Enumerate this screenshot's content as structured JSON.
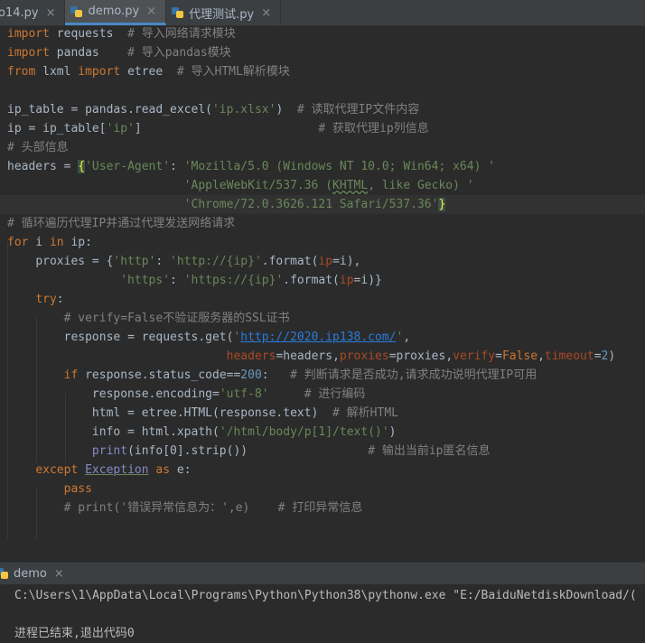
{
  "tabs": [
    {
      "label": "o14.py",
      "active": false
    },
    {
      "label": "demo.py",
      "active": true
    },
    {
      "label": "代理测试.py",
      "active": false
    }
  ],
  "code": {
    "l1_kw": "import",
    "l1_mod": " requests",
    "l1_cm": "  # 导入网络请求模块",
    "l2_kw": "import",
    "l2_mod": " pandas",
    "l2_cm": "    # 导入pandas模块",
    "l3_kw1": "from",
    "l3_mod": " lxml ",
    "l3_kw2": "import",
    "l3_name": " etree",
    "l3_cm": "  # 导入HTML解析模块",
    "l5_pre": "ip_table = pandas.read_excel(",
    "l5_str": "'ip.xlsx'",
    "l5_post": ")",
    "l5_cm": "  # 读取代理IP文件内容",
    "l6_pre": "ip = ip_table[",
    "l6_str": "'ip'",
    "l6_post": "]",
    "l6_cm": "# 获取代理ip列信息",
    "l7_cm": "# 头部信息",
    "l8_pre": "headers = ",
    "l8_brace": "{",
    "l8_key": "'User-Agent'",
    "l8_colon": ": ",
    "l8_str": "'Mozilla/5.0 (Windows NT 10.0; Win64; x64) '",
    "l9_s1": "'AppleWebKit/537.36 (",
    "l9_sq": "KHTML",
    "l9_s2": ", like Gecko) '",
    "l10_str": "'Chrome/72.0.3626.121 Safari/537.36'",
    "l10_brace": "}",
    "l11_cm": "# 循环遍历代理IP并通过代理发送网络请求",
    "l12_kw1": "for",
    "l12_mid": " i ",
    "l12_kw2": "in",
    "l12_post": " ip:",
    "l13_pre": "proxies = {",
    "l13_k": "'http'",
    "l13_c": ": ",
    "l13_v": "'http://{ip}'",
    "l13_f": ".format(",
    "l13_p": "ip",
    "l13_e": "=i),",
    "l14_k": "'https'",
    "l14_c": ": ",
    "l14_v": "'https://{ip}'",
    "l14_f": ".format(",
    "l14_p": "ip",
    "l14_e": "=i)}",
    "l15_kw": "try",
    "l15_post": ":",
    "l16_cm": "# verify=False不验证服务器的SSL证书",
    "l17_pre": "response = requests.get(",
    "l17_q1": "'",
    "l17_link": "http://2020.ip138.com/",
    "l17_q2": "'",
    "l17_post": ",",
    "l18_p1": "headers",
    "l18_v1": "=headers",
    "l18_c1": ",",
    "l18_p2": "proxies",
    "l18_v2": "=proxies",
    "l18_c2": ",",
    "l18_p3": "verify",
    "l18_eq3": "=",
    "l18_v3": "False",
    "l18_c3": ",",
    "l18_p4": "timeout",
    "l18_eq4": "=",
    "l18_v4": "2",
    "l18_end": ")",
    "l19_kw": "if",
    "l19_mid": " response.status_code==",
    "l19_num": "200",
    "l19_colon": ":",
    "l19_cm": "   # 判断请求是否成功,请求成功说明代理IP可用",
    "l20_pre": "response.encoding=",
    "l20_str": "'utf-8'",
    "l20_cm": "     # 进行编码",
    "l21_pre": "html = etree.HTML(response.text)",
    "l21_cm": "  # 解析HTML",
    "l22_pre": "info = html.xpath(",
    "l22_str": "'/html/body/p[1]/text()'",
    "l22_post": ")",
    "l23_bi": "print",
    "l23_post": "(info[0].strip())",
    "l23_cm": "# 输出当前ip匿名信息",
    "l24_kw1": "except",
    "l24_exc": "Exception",
    "l24_kw2": "as",
    "l24_post": " e:",
    "l25_kw": "pass",
    "l26_cm": "# print('错误异常信息为：',e)    # 打印异常信息"
  },
  "run": {
    "tab_label": "demo",
    "console_line1": "C:\\Users\\1\\AppData\\Local\\Programs\\Python\\Python38\\pythonw.exe \"E:/BaiduNetdiskDownload/(",
    "console_line3": "进程已结束,退出代码0"
  }
}
